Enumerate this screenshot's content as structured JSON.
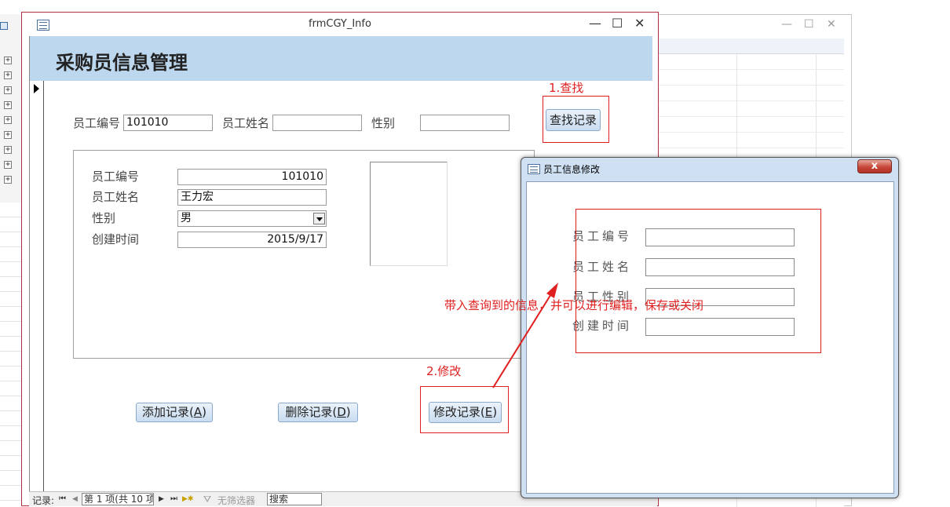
{
  "main_window": {
    "title": "frmCGY_Info",
    "minimize": "—",
    "maximize": "☐",
    "close": "✕"
  },
  "header": {
    "title": "采购员信息管理"
  },
  "search": {
    "emp_no_label": "员工编号",
    "emp_no_value": "101010",
    "emp_name_label": "员工姓名",
    "emp_name_value": "",
    "gender_label": "性别",
    "gender_value": "",
    "find_button": "查找记录"
  },
  "detail": {
    "emp_no_label": "员工编号",
    "emp_no_value": "101010",
    "emp_name_label": "员工姓名",
    "emp_name_value": "王力宏",
    "gender_label": "性别",
    "gender_value": "男",
    "created_label": "创建时间",
    "created_value": "2015/9/17"
  },
  "buttons": {
    "add": "添加记录(",
    "add_key": "A",
    "delete": "删除记录(",
    "delete_key": "D",
    "modify": "修改记录(",
    "modify_key": "E",
    "close_paren": ")"
  },
  "annotations": {
    "step1": "1.查找",
    "step2": "2.修改",
    "note": "带入查询到的信息，并可以进行编辑，保存或关闭"
  },
  "nav_bar": {
    "record_label": "记录:",
    "first": "⏮",
    "prev": "◀",
    "position": "第 1 项(共 10 项",
    "next": "▶",
    "last": "⏭",
    "new": "▶✱",
    "filter": "无筛选器",
    "search_label": "搜索"
  },
  "dialog": {
    "title": "员工信息修改",
    "close": "x",
    "fields": [
      {
        "label": "员工编号",
        "value": ""
      },
      {
        "label": "员工姓名",
        "value": ""
      },
      {
        "label": "员工性别",
        "value": ""
      },
      {
        "label": "创建时间",
        "value": ""
      }
    ]
  },
  "bg_window": {
    "minimize": "—",
    "maximize": "☐",
    "close": "✕"
  },
  "left_strip": {
    "expanders": [
      "+",
      "+",
      "+",
      "+",
      "+",
      "+",
      "+",
      "+",
      "+"
    ]
  },
  "colors": {
    "header_band": "#bdd7ee",
    "annotation_red": "#e02020",
    "window_border": "#b03040",
    "dialog_frame": "#cfe0f3"
  }
}
